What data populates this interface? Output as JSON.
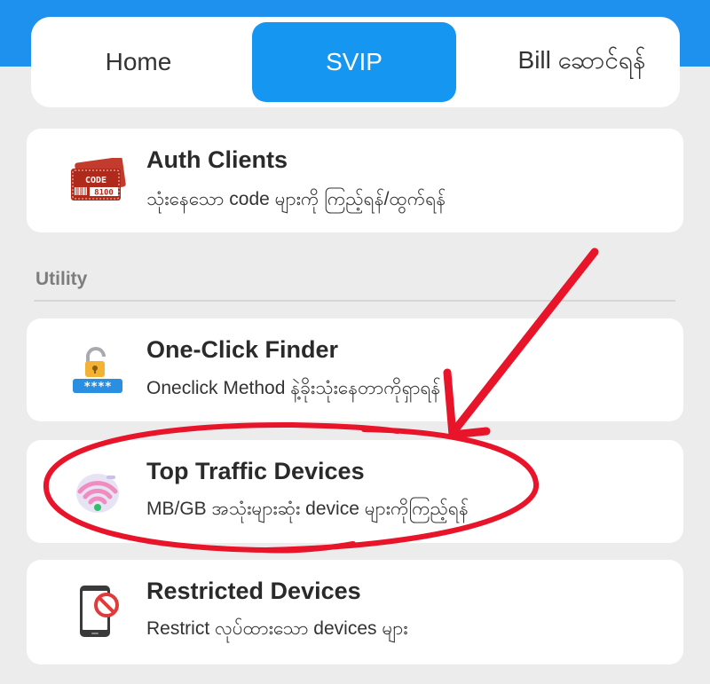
{
  "tabs": [
    {
      "label": "Home"
    },
    {
      "label": "SVIP"
    },
    {
      "label": "Bill ဆောင်ရန်"
    }
  ],
  "cards": [
    {
      "title": "Auth Clients",
      "subtitle": "သုံးနေသော code များကို ကြည့်ရန်/ထွက်ရန်",
      "icon": "code-ticket-icon",
      "icon_text_1": "CODE",
      "icon_text_2": "8100"
    },
    {
      "title": "One-Click Finder",
      "subtitle": "Oneclick Method နဲ့ခိုးသုံးနေတာကိုရှာရန်",
      "icon": "padlock-password-icon",
      "icon_text": "****"
    },
    {
      "title": "Top Traffic Devices",
      "subtitle": "MB/GB အသုံးများဆုံး device များကိုကြည့်ရန်",
      "icon": "wifi-traffic-icon"
    },
    {
      "title": "Restricted Devices",
      "subtitle": "Restrict လုပ်ထားသော devices များ",
      "icon": "phone-blocked-icon"
    }
  ],
  "section": {
    "utility_label": "Utility"
  },
  "colors": {
    "header_blue": "#1e90ee",
    "tab_active": "#1596f0",
    "annotation_red": "#e8142a",
    "background": "#ececec"
  }
}
